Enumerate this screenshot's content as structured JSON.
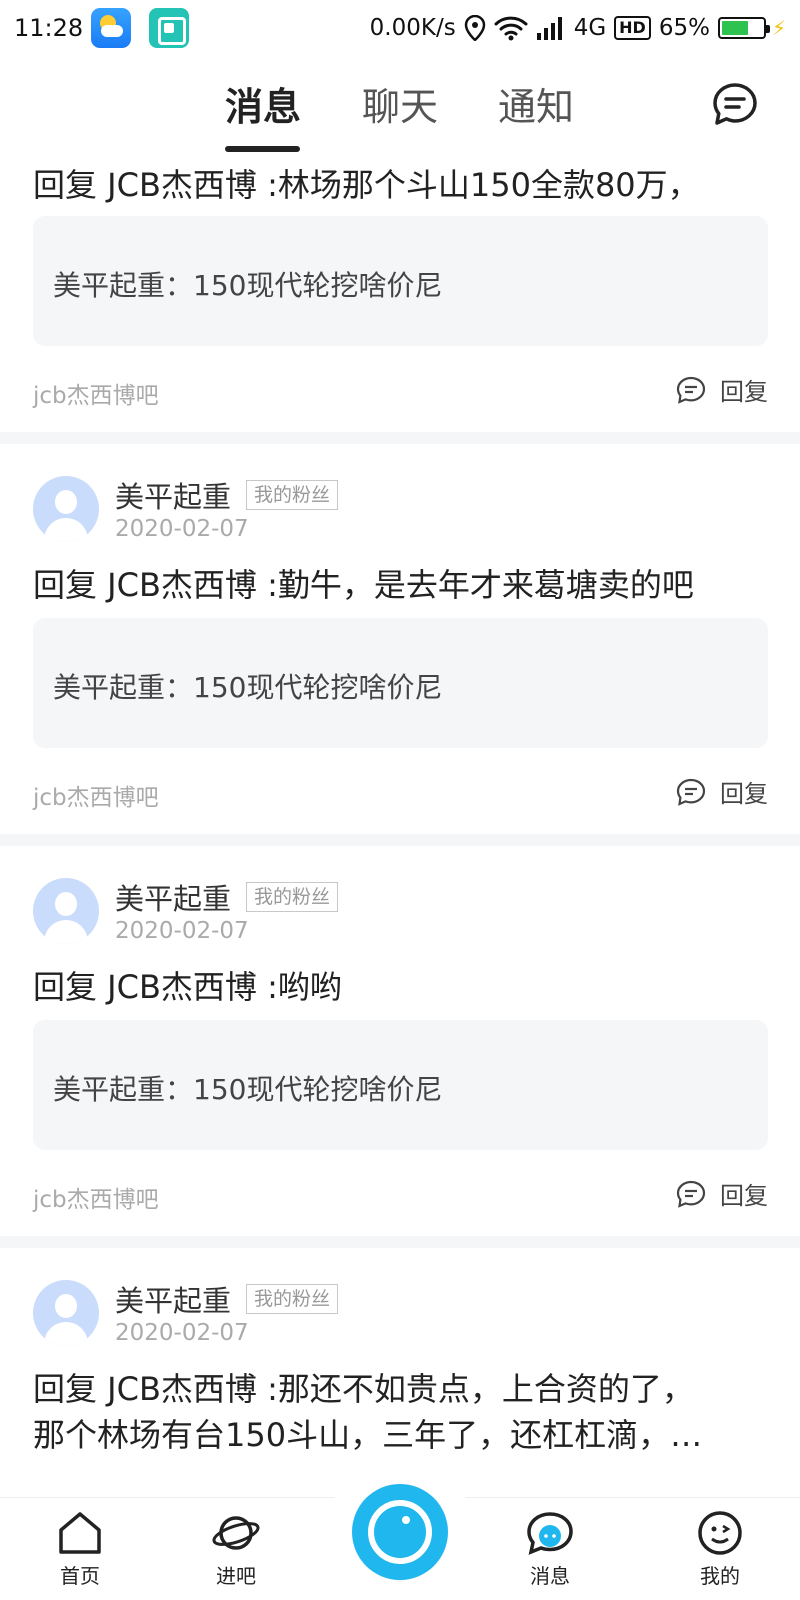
{
  "status_bar": {
    "time": "11:28",
    "network_speed": "0.00K/s",
    "network_type": "4G",
    "hd_label": "HD",
    "battery_percent": "65%",
    "battery_level": 0.65
  },
  "tabs": [
    {
      "label": "消息",
      "active": true
    },
    {
      "label": "聊天",
      "active": false
    },
    {
      "label": "通知",
      "active": false
    }
  ],
  "items": [
    {
      "reply": "回复 JCB杰西博 :林场那个斗山150全款80万，",
      "quote": "美平起重：150现代轮挖啥价尼",
      "forum": "jcb杰西博吧",
      "reply_label": "回复"
    },
    {
      "user": "美平起重",
      "badge": "我的粉丝",
      "date": "2020-02-07",
      "reply": "回复 JCB杰西博 :勤牛，是去年才来葛塘卖的吧",
      "quote": "美平起重：150现代轮挖啥价尼",
      "forum": "jcb杰西博吧",
      "reply_label": "回复"
    },
    {
      "user": "美平起重",
      "badge": "我的粉丝",
      "date": "2020-02-07",
      "reply": "回复 JCB杰西博 :哟哟",
      "quote": "美平起重：150现代轮挖啥价尼",
      "forum": "jcb杰西博吧",
      "reply_label": "回复"
    },
    {
      "user": "美平起重",
      "badge": "我的粉丝",
      "date": "2020-02-07",
      "reply_line1": "回复 JCB杰西博 :那还不如贵点，上合资的了，",
      "reply_line2": "那个林场有台150斗山，三年了，还杠杠滴，…"
    }
  ],
  "bottom_nav": [
    {
      "label": "首页",
      "icon": "home-icon"
    },
    {
      "label": "进吧",
      "icon": "planet-icon"
    },
    {
      "label": "",
      "icon": "camera-lens-icon"
    },
    {
      "label": "消息",
      "icon": "message-bubble-icon"
    },
    {
      "label": "我的",
      "icon": "wink-face-icon"
    }
  ],
  "colors": {
    "accent_blue": "#1fb7ee",
    "avatar_bg": "#c9dcfb",
    "battery_green": "#2ec24e"
  }
}
